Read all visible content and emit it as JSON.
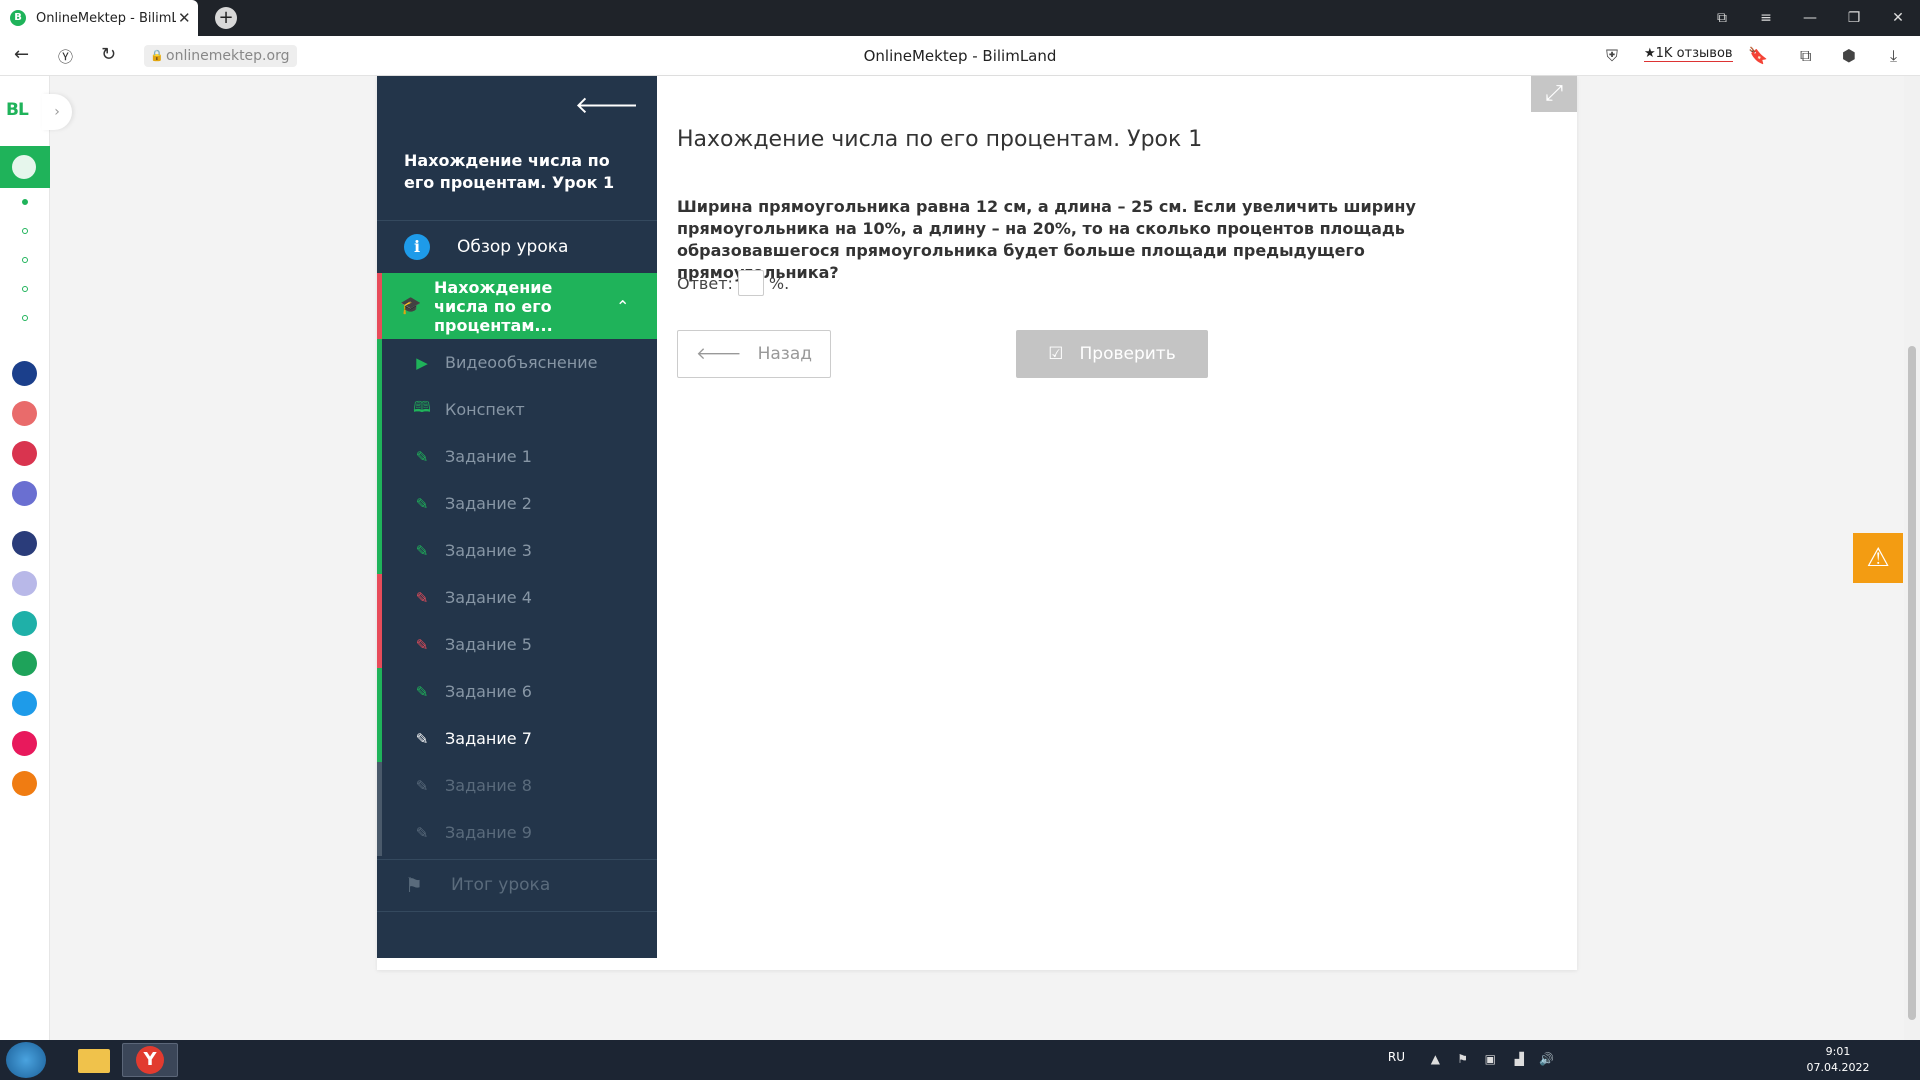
{
  "browser": {
    "tab_title": "OnlineMektep - BilimLand",
    "tab_favicon": "B",
    "url": "onlinemektep.org",
    "page_title": "OnlineMektep - BilimLand",
    "reviews_label": "★1K отзывов"
  },
  "rail": {
    "logo": "BL"
  },
  "sidebar": {
    "lesson_title": "Нахождение числа по его процентам. Урок 1",
    "overview_label": "Обзор урока",
    "section_label": "Нахождение числа по его процентам...",
    "items": [
      {
        "label": "Видеообъяснение",
        "status": "done"
      },
      {
        "label": "Конспект",
        "status": "done"
      },
      {
        "label": "Задание 1",
        "status": "correct"
      },
      {
        "label": "Задание 2",
        "status": "correct"
      },
      {
        "label": "Задание 3",
        "status": "correct"
      },
      {
        "label": "Задание 4",
        "status": "wrong"
      },
      {
        "label": "Задание 5",
        "status": "wrong"
      },
      {
        "label": "Задание 6",
        "status": "correct"
      },
      {
        "label": "Задание 7",
        "status": "active"
      },
      {
        "label": "Задание 8",
        "status": "pending"
      },
      {
        "label": "Задание 9",
        "status": "pending"
      }
    ],
    "result_label": "Итог урока"
  },
  "content": {
    "title": "Нахождение числа по его процентам. Урок 1",
    "question": "Ширина прямоугольника равна 12 см, а длина – 25 см. Если увеличить ширину прямоугольника на 10%, а длину – на 20%, то на сколько процентов площадь образовавшегося прямоугольника будет больше площади предыдущего прямоугольника?",
    "answer_label": "Ответ:",
    "answer_value": "",
    "answer_unit": "%.",
    "back_label": "Назад",
    "check_label": "Проверить"
  },
  "taskbar": {
    "lang": "RU",
    "time": "9:01",
    "date": "07.04.2022"
  },
  "colors": {
    "green": "#1fb35a",
    "red": "#e74c5a",
    "sidebar_bg": "#23354a",
    "warning": "#f39c12"
  }
}
